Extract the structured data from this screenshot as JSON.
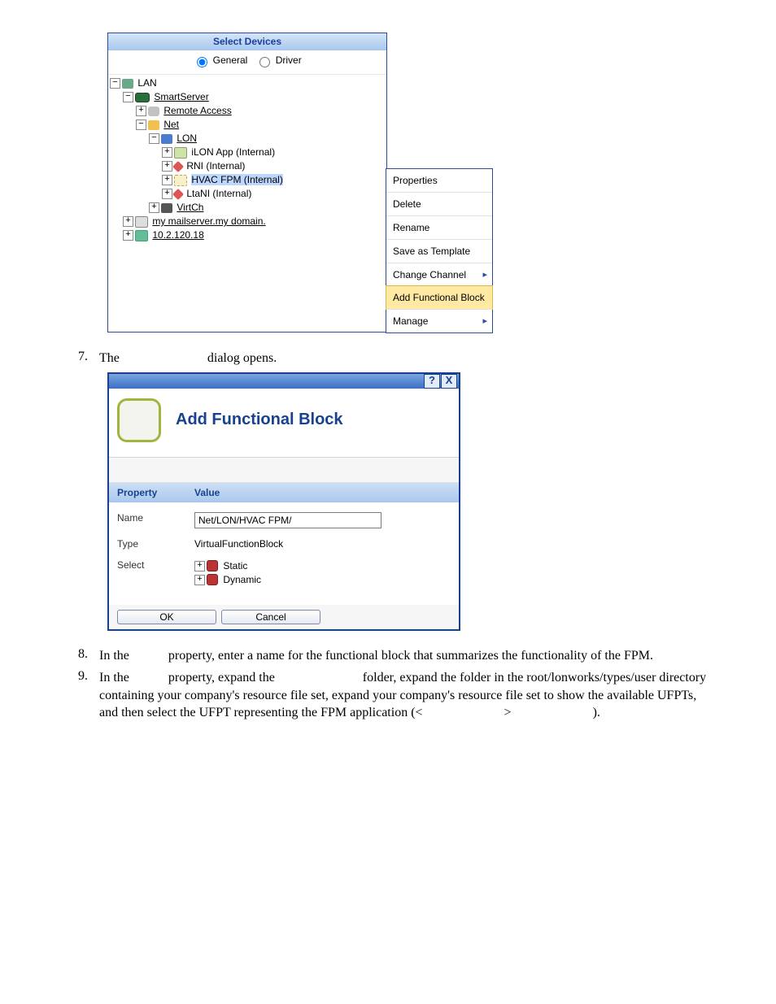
{
  "tree": {
    "header": "Select Devices",
    "radio_general": "General",
    "radio_driver": "Driver",
    "lan": "LAN",
    "smartserver": "SmartServer",
    "remote_access": "Remote Access",
    "net": "Net",
    "lon": "LON",
    "ilon_app": "iLON App (Internal)",
    "rni": "RNI (Internal)",
    "hvac_fpm": "HVAC FPM (Internal)",
    "ltani": "LtaNI (Internal)",
    "virtch": "VirtCh",
    "mailserver": "my mailserver.my domain.",
    "host": "10.2.120.18"
  },
  "context_menu": {
    "properties": "Properties",
    "delete": "Delete",
    "rename": "Rename",
    "save_template": "Save as Template",
    "change_channel": "Change Channel",
    "add_fb": "Add Functional Block",
    "manage": "Manage"
  },
  "step7": {
    "num": "7.",
    "pre": "The ",
    "post": " dialog opens."
  },
  "dialog": {
    "title": "Add Functional Block",
    "help": "?",
    "close": "X",
    "col_property": "Property",
    "col_value": "Value",
    "name_label": "Name",
    "name_value": "Net/LON/HVAC FPM/",
    "type_label": "Type",
    "type_value": "VirtualFunctionBlock",
    "select_label": "Select",
    "static": "Static",
    "dynamic": "Dynamic",
    "ok": "OK",
    "cancel": "Cancel"
  },
  "step8": {
    "num": "8.",
    "t1": "In the ",
    "t2": " property, enter a name for the functional block that summarizes the functionality of the FPM."
  },
  "step9": {
    "num": "9.",
    "t1": "In the ",
    "t2": " property, expand the ",
    "t3": " folder, expand the folder in the root/lonworks/types/user directory containing your company's resource file set, expand your company's resource file set to show the available UFPTs, and then select the UFPT representing the FPM application (<",
    "t4": ">",
    "t5": ")."
  }
}
